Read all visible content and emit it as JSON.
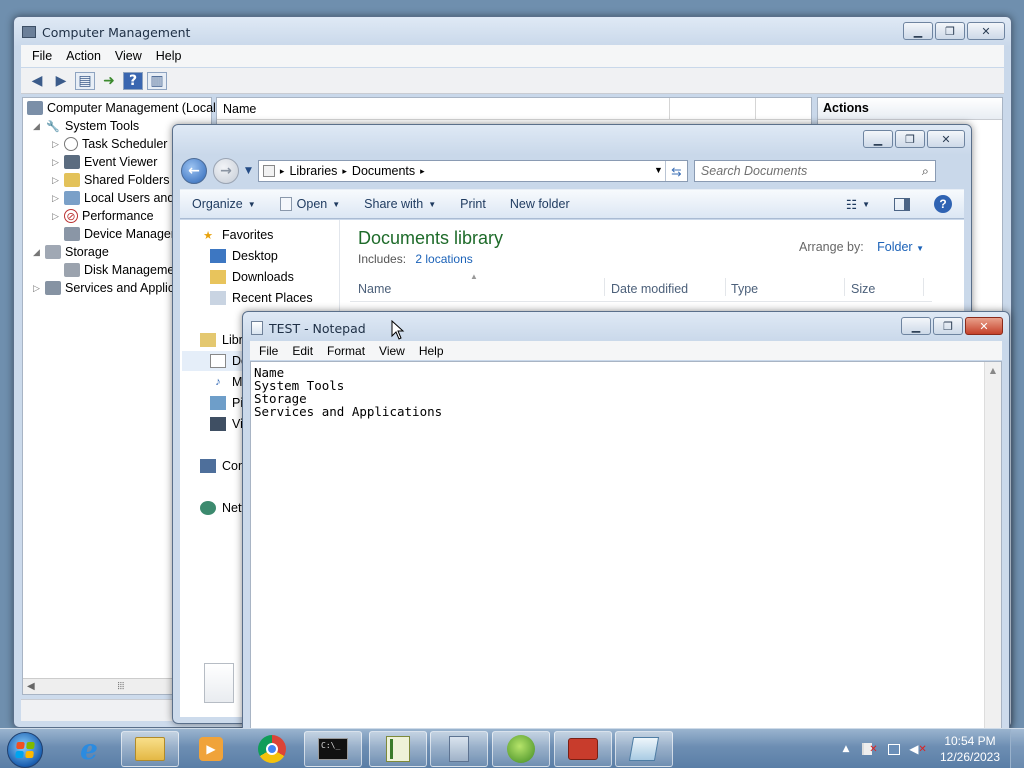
{
  "computer_management": {
    "title": "Computer Management",
    "menu": [
      "File",
      "Action",
      "View",
      "Help"
    ],
    "tree": [
      {
        "label": "Computer Management (Local",
        "level": 0
      },
      {
        "label": "System Tools",
        "level": 1
      },
      {
        "label": "Task Scheduler",
        "level": 2
      },
      {
        "label": "Event Viewer",
        "level": 2
      },
      {
        "label": "Shared Folders",
        "level": 2
      },
      {
        "label": "Local Users and G",
        "level": 2
      },
      {
        "label": "Performance",
        "level": 2
      },
      {
        "label": "Device Manager",
        "level": 2
      },
      {
        "label": "Storage",
        "level": 1
      },
      {
        "label": "Disk Management",
        "level": 2
      },
      {
        "label": "Services and Applica",
        "level": 1
      }
    ],
    "center_header": "Name",
    "actions_header": "Actions"
  },
  "explorer": {
    "breadcrumb": [
      "Libraries",
      "Documents"
    ],
    "search_placeholder": "Search Documents",
    "commands": [
      "Organize",
      "Open",
      "Share with",
      "Print",
      "New folder"
    ],
    "nav": {
      "favorites": "Favorites",
      "desktop": "Desktop",
      "downloads": "Downloads",
      "recent": "Recent Places",
      "libraries": "Libr",
      "documents": "Do",
      "music": "M",
      "pictures": "Pi",
      "videos": "Vi",
      "computer": "Com",
      "network": "Netv"
    },
    "library_title": "Documents library",
    "includes_label": "Includes:",
    "includes_link": "2 locations",
    "arrange_label": "Arrange by:",
    "arrange_value": "Folder",
    "columns": [
      "Name",
      "Date modified",
      "Type",
      "Size"
    ]
  },
  "notepad": {
    "title": "TEST - Notepad",
    "menu": [
      "File",
      "Edit",
      "Format",
      "View",
      "Help"
    ],
    "content": "Name\nSystem Tools\nStorage\nServices and Applications"
  },
  "taskbar": {
    "clock_time": "10:54 PM",
    "clock_date": "12/26/2023",
    "cmd_label": "C:\\_"
  },
  "colors": {
    "library_title": "#1e6b2a",
    "link": "#1b62b8"
  }
}
